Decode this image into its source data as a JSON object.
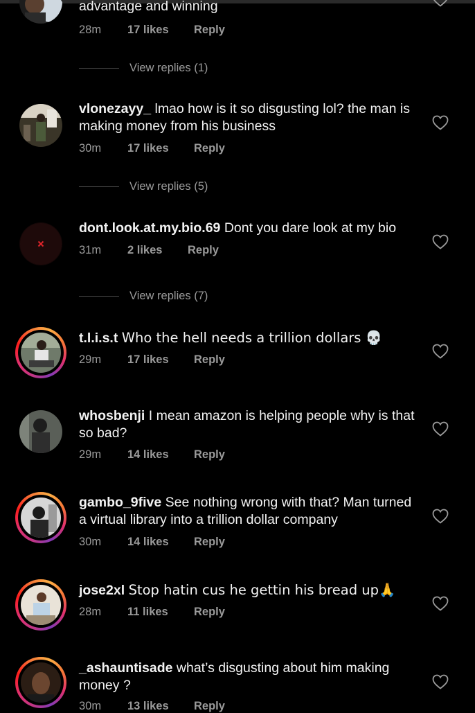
{
  "colors": {
    "background": "#000000",
    "text": "#f2f2f2",
    "muted": "#9a9a9a",
    "story_ring": "#e1306c"
  },
  "comments": [
    {
      "username": "",
      "text": "advantage and winning",
      "time": "28m",
      "likes": "17 likes",
      "reply": "Reply",
      "view_replies": "View replies (1)",
      "avatar_icon": "profile-photo"
    },
    {
      "username": "vlonezayy_",
      "text": "lmao how is it so disgusting lol? the man is making money from his business",
      "time": "30m",
      "likes": "17 likes",
      "reply": "Reply",
      "view_replies": "View replies (5)",
      "avatar_icon": "profile-photo"
    },
    {
      "username": "dont.look.at.my.bio.69",
      "text": "Dont you dare look at my bio",
      "time": "31m",
      "likes": "2 likes",
      "reply": "Reply",
      "view_replies": "View replies (7)",
      "avatar_icon": "profile-photo"
    },
    {
      "username": "t.l.i.s.t",
      "text": "Who the hell needs a trillion dollars 💀",
      "time": "29m",
      "likes": "17 likes",
      "reply": "Reply",
      "avatar_icon": "profile-photo"
    },
    {
      "username": "whosbenji",
      "text": "I mean amazon is helping people why is that so bad?",
      "time": "29m",
      "likes": "14 likes",
      "reply": "Reply",
      "avatar_icon": "profile-photo"
    },
    {
      "username": "gambo_9five",
      "text": "See nothing wrong with that? Man turned a virtual library into a trillion dollar company",
      "time": "30m",
      "likes": "14 likes",
      "reply": "Reply",
      "avatar_icon": "profile-photo"
    },
    {
      "username": "jose2xl",
      "text": "Stop hatin cus he gettin his bread up🙏",
      "time": "28m",
      "likes": "11 likes",
      "reply": "Reply",
      "avatar_icon": "profile-photo"
    },
    {
      "username": "_ashauntisade",
      "text": "what’s disgusting about him making money ?",
      "time": "30m",
      "likes": "13 likes",
      "reply": "Reply",
      "avatar_icon": "profile-photo"
    }
  ]
}
